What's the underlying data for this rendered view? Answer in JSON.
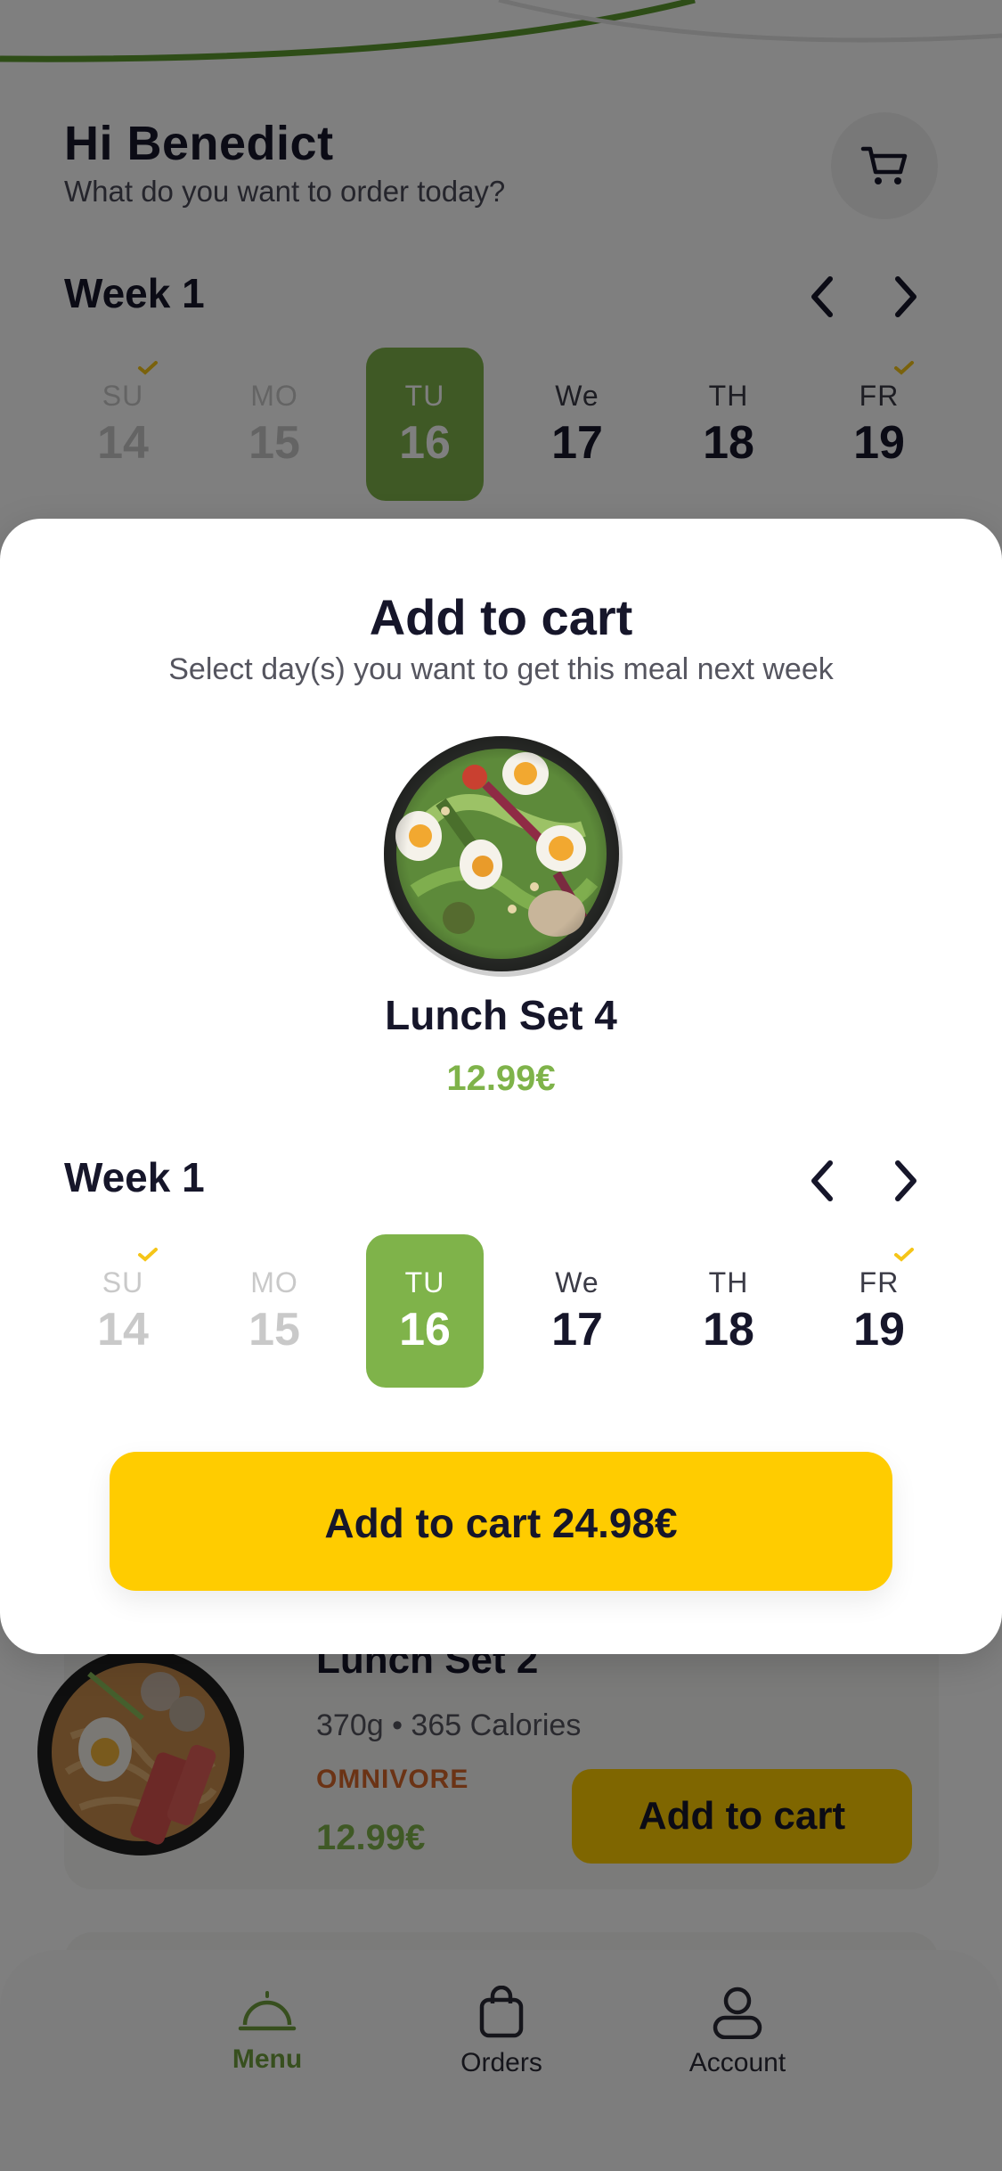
{
  "header": {
    "greeting": "Hi Benedict",
    "subtitle": "What do you want to order today?"
  },
  "week": {
    "label": "Week 1",
    "days": [
      {
        "name": "SU",
        "num": "14",
        "state": "past",
        "checked": true
      },
      {
        "name": "MO",
        "num": "15",
        "state": "past",
        "checked": false
      },
      {
        "name": "TU",
        "num": "16",
        "state": "selected",
        "checked": false
      },
      {
        "name": "We",
        "num": "17",
        "state": "future",
        "checked": false
      },
      {
        "name": "TH",
        "num": "18",
        "state": "future",
        "checked": false
      },
      {
        "name": "FR",
        "num": "19",
        "state": "future",
        "checked": true
      }
    ]
  },
  "modal": {
    "title": "Add to cart",
    "subtitle": "Select day(s) you want to get this meal next week",
    "meal_name": "Lunch Set 4",
    "meal_price": "12.99€",
    "week_label": "Week 1",
    "button_label": "Add to cart 24.98€"
  },
  "meal_card": {
    "title": "Lunch Set 2",
    "meta": "370g • 365 Calories",
    "tag": "OMNIVORE",
    "price": "12.99€",
    "button_label": "Add to cart"
  },
  "tabbar": {
    "items": [
      {
        "label": "Menu",
        "icon": "cloche-icon",
        "active": true
      },
      {
        "label": "Orders",
        "icon": "bag-icon",
        "active": false
      },
      {
        "label": "Account",
        "icon": "user-icon",
        "active": false
      }
    ]
  },
  "colors": {
    "accent_green": "#7fb34a",
    "button_yellow": "#ffcc00",
    "tag_orange": "#d6672a",
    "check_yellow": "#f5c518"
  }
}
